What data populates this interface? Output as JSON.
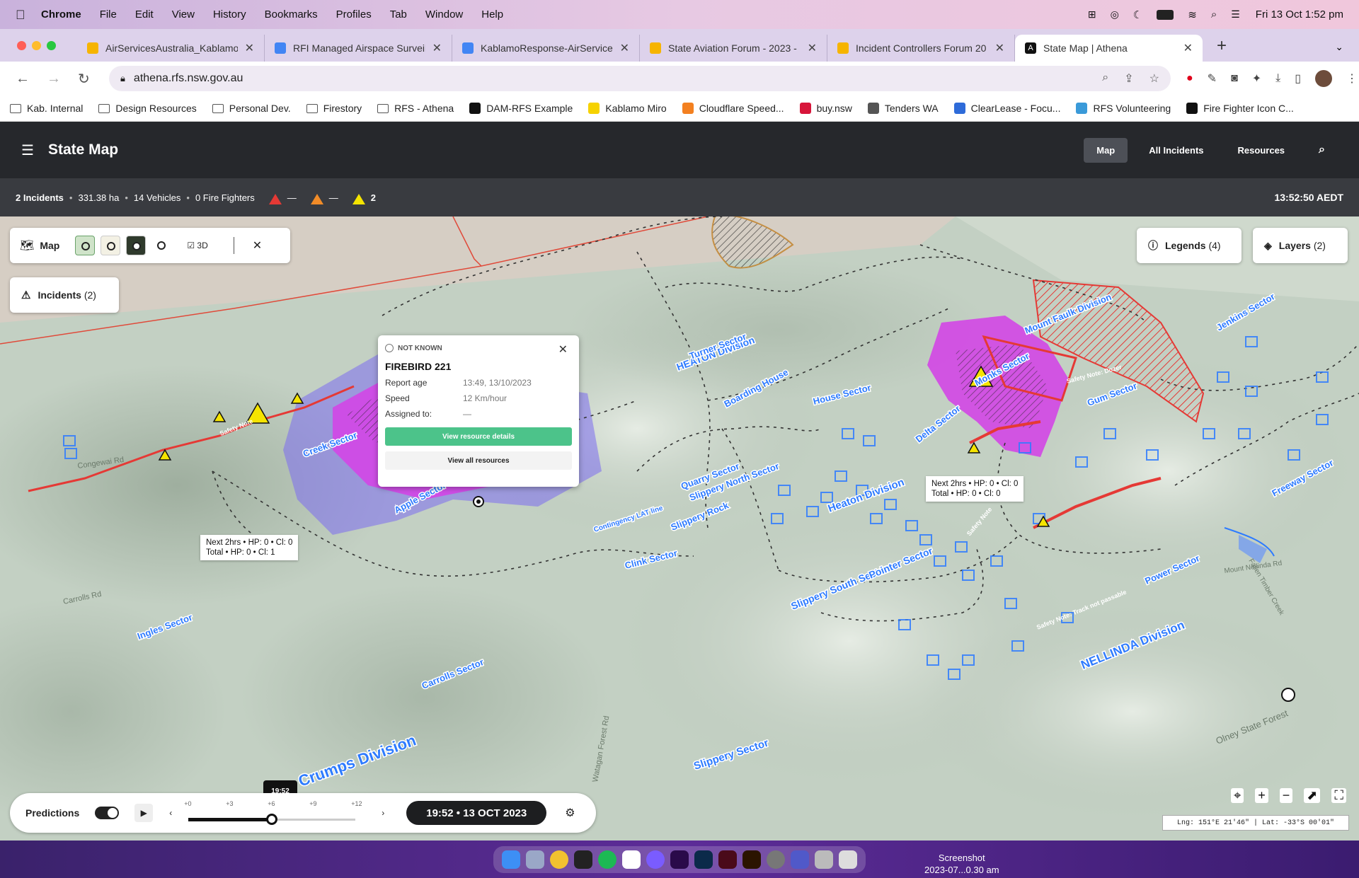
{
  "os_menu": {
    "app": "Chrome",
    "items": [
      "File",
      "Edit",
      "View",
      "History",
      "Bookmarks",
      "Profiles",
      "Tab",
      "Window",
      "Help"
    ],
    "datetime": "Fri 13 Oct  1:52 pm"
  },
  "tabs": [
    {
      "title": "AirServicesAustralia_Kablamo",
      "color": "#f6b400"
    },
    {
      "title": "RFI Managed Airspace Surveill",
      "color": "#4285f4"
    },
    {
      "title": "KablamoResponse-AirService",
      "color": "#4285f4"
    },
    {
      "title": "State Aviation Forum - 2023 -",
      "color": "#f6b400"
    },
    {
      "title": "Incident Controllers Forum 20",
      "color": "#f6b400"
    },
    {
      "title": "State Map | Athena",
      "color": "#111111"
    }
  ],
  "url": "athena.rfs.nsw.gov.au",
  "bookmarks": [
    {
      "label": "Kab. Internal",
      "type": "folder"
    },
    {
      "label": "Design Resources",
      "type": "folder"
    },
    {
      "label": "Personal Dev.",
      "type": "folder"
    },
    {
      "label": "Firestory",
      "type": "folder"
    },
    {
      "label": "RFS - Athena",
      "type": "folder"
    },
    {
      "label": "DAM-RFS Example",
      "type": "site",
      "color": "#111111"
    },
    {
      "label": "Kablamo Miro",
      "type": "site",
      "color": "#f6d200"
    },
    {
      "label": "Cloudflare Speed...",
      "type": "site",
      "color": "#f38020"
    },
    {
      "label": "buy.nsw",
      "type": "site",
      "color": "#d7153a"
    },
    {
      "label": "Tenders WA",
      "type": "site",
      "color": "#555555"
    },
    {
      "label": "ClearLease - Focu...",
      "type": "site",
      "color": "#2e6bd9"
    },
    {
      "label": "RFS Volunteering",
      "type": "site",
      "color": "#3a9ad9"
    },
    {
      "label": "Fire Fighter Icon C...",
      "type": "site",
      "color": "#111111"
    }
  ],
  "header": {
    "title": "State Map",
    "nav": [
      "Map",
      "All Incidents",
      "Resources"
    ],
    "active_nav": "Map"
  },
  "stats": {
    "incidents": "2 Incidents",
    "area": "331.38 ha",
    "vehicles": "14 Vehicles",
    "firefighters": "0 Fire Fighters",
    "emergency_count": "—",
    "watch_count": "—",
    "advice_count": "2",
    "clock": "13:52:50 AEDT",
    "colors": {
      "emergency": "#e53935",
      "watch": "#f28c28",
      "advice": "#f5e400"
    }
  },
  "map_controls": {
    "map_label": "Map",
    "three_d": "3D",
    "incidents_btn": "Incidents",
    "incidents_count": "(2)",
    "legends_btn": "Legends",
    "legends_count": "(4)",
    "layers_btn": "Layers",
    "layers_count": "(2)"
  },
  "popup": {
    "status": "NOT KNOWN",
    "name": "FIREBIRD 221",
    "rows": [
      {
        "k": "Report age",
        "v": "13:49, 13/10/2023"
      },
      {
        "k": "Speed",
        "v": "12 Km/hour"
      },
      {
        "k": "Assigned to:",
        "v": "—"
      }
    ],
    "primary_btn": "View resource details",
    "secondary_btn": "View all resources"
  },
  "callouts": [
    {
      "line1": "Next 2hrs  •  HP: 0  •  Cl: 0",
      "line2": "Total  •  HP: 0  •  Cl: 1"
    },
    {
      "line1": "Next 2hrs  •  HP: 0  •  Cl: 0",
      "line2": "Total  •  HP: 0  •  Cl: 0"
    }
  ],
  "map_labels": {
    "sectors": [
      "Creek Sector",
      "Apple Sector",
      "Ingles Sector",
      "Carrolls Sector",
      "Crumps Division",
      "Clink Sector",
      "Slippery Rock",
      "Quarry Sector",
      "Slippery North Sector",
      "Heaton Division",
      "HEATON Division",
      "Turner Sector",
      "House Sector",
      "Boarding House",
      "Slippery South Sector",
      "Pointer Sector",
      "Slippery Sector",
      "Power Sector",
      "NELLINDA Division",
      "Mount Faulk Division",
      "Jenkins Sector",
      "Freeway Sector",
      "Delta Sector",
      "Monks Sector",
      "Gum Sector",
      "Contingency LAT line"
    ],
    "roads": [
      "Congewai Rd",
      "Carrolls Rd",
      "Watagan Forest Rd",
      "Olney State Forest",
      "Fallen Timber Creek",
      "Mount Nellinda Rd"
    ],
    "red_notes": [
      "Safety Note",
      "Safety Note: Track not passable",
      "Safety Note: Dozer"
    ]
  },
  "timeline": {
    "label": "Predictions",
    "ticks": [
      "+0",
      "+3",
      "+6",
      "+9",
      "+12"
    ],
    "tooltip": "19:52",
    "position": 0.5,
    "datetime": "19:52  •  13 OCT 2023"
  },
  "coords": "Lng: 151°E 21'46\"  |  Lat: -33°S 00'01\"",
  "dock_label": {
    "line1": "Screenshot",
    "line2": "2023-07...0.30 am"
  }
}
